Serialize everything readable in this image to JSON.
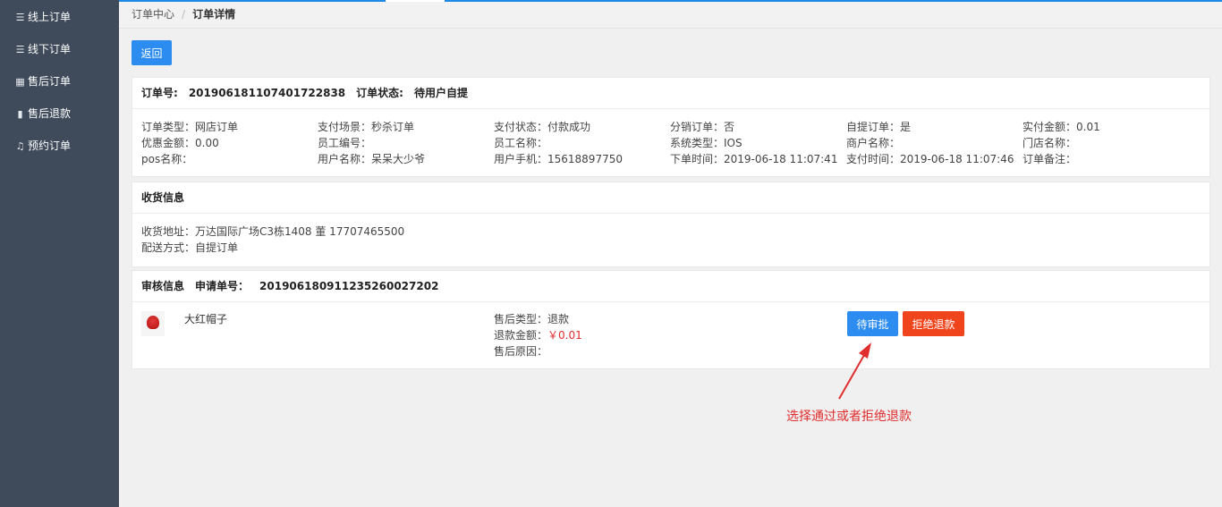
{
  "sidebar": {
    "items": [
      {
        "icon": "list-icon",
        "label": "线上订单"
      },
      {
        "icon": "list-icon",
        "label": "线下订单"
      },
      {
        "icon": "table-icon",
        "label": "售后订单"
      },
      {
        "icon": "document-icon",
        "label": "售后退款"
      },
      {
        "icon": "bell-icon",
        "label": "预约订单"
      }
    ]
  },
  "breadcrumb": {
    "parent": "订单中心",
    "separator": "/",
    "current": "订单详情"
  },
  "back_label": "返回",
  "order": {
    "no_label": "订单号:",
    "no": "20190618110740172283​8",
    "status_label": "订单状态:",
    "status": "待用户自提",
    "fields": [
      "订单类型：网店订单",
      "支付场景：秒杀订单",
      "支付状态：付款成功",
      "分销订单：否",
      "自提订单：是",
      "实付金额：0.01",
      "优惠金额：0.00",
      "员工编号：",
      "员工名称：",
      "系统类型：IOS",
      "商户名称：",
      "门店名称：",
      "pos名称：",
      "用户名称：呆呆大少爷",
      "用户手机：15618897750",
      "下单时间：2019-06-18 11:07:41",
      "支付时间：2019-06-18 11:07:46",
      "订单备注："
    ]
  },
  "receipt": {
    "title": "收货信息",
    "address": "收货地址：万达国际广场C3栋1408 董 17707465500",
    "delivery": "配送方式：自提订单"
  },
  "audit": {
    "title": "审核信息",
    "apply_label": "申请单号：",
    "apply_no": "20190618091123526002720​2",
    "product_name": "大红帽子",
    "type": "售后类型：退款",
    "amount_label": "退款金额：",
    "amount": "￥0.01",
    "reason": "售后原因：",
    "approve_label": "待审批",
    "reject_label": "拒绝退款"
  },
  "annotation": "选择通过或者拒绝退款",
  "colors": {
    "sidebar": "#3f4a5a",
    "primary": "#2d8cf0",
    "danger": "#f0441c",
    "annotation": "#e02d2d"
  }
}
